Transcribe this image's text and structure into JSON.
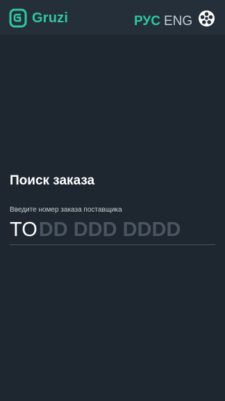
{
  "header": {
    "logo_text": "Gruzi",
    "languages": [
      {
        "label": "РУС",
        "active": true
      },
      {
        "label": "ENG",
        "active": false
      }
    ],
    "settings_icon": "settings-gear-icon"
  },
  "search": {
    "title": "Поиск заказа",
    "label": "Введите номер заказа поставщика",
    "prefix": "TO",
    "mask": "DD DDD DDDD"
  },
  "colors": {
    "accent": "#2fc7a1",
    "background": "#1e2730",
    "header_background": "#252f3a",
    "mask": "#4a5562"
  }
}
